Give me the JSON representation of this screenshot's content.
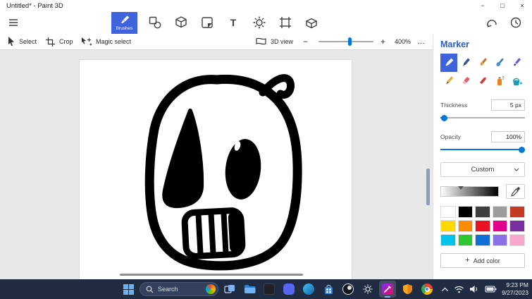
{
  "colors": {
    "accent_blue": "#3e63dd",
    "slider_blue": "#0078d7",
    "panel_title_blue": "#2a5cc8",
    "taskbar_bg": "#202c42",
    "canvas_workspace_bg": "#e8e8e8",
    "ink": "#000000"
  },
  "window": {
    "title": "Untitled* - Paint 3D",
    "minimize_glyph": "−",
    "maximize_glyph": "□",
    "close_glyph": "×"
  },
  "main_toolbar": {
    "selected_tool_label": "Brushes",
    "text_tool_glyph": "T",
    "tool_icons": [
      "menu-icon",
      "brushes-icon",
      "2d-shapes-icon",
      "3d-shapes-icon",
      "stickers-icon",
      "text-icon",
      "effects-icon",
      "canvas-icon",
      "3d-library-icon",
      "undo-icon",
      "history-icon"
    ]
  },
  "sub_toolbar": {
    "select": "Select",
    "crop": "Crop",
    "magic_select": "Magic select",
    "view_3d": "3D view",
    "zoom_out_glyph": "−",
    "zoom_in_glyph": "+",
    "zoom_level": "400%",
    "more_glyph": "…"
  },
  "panel": {
    "title": "Marker",
    "brush_icons": [
      "marker-icon",
      "calligraphy-pen-icon",
      "oil-brush-icon",
      "watercolour-icon",
      "pixel-pen-icon",
      "pencil-icon",
      "eraser-icon",
      "crayon-icon",
      "spray-can-icon",
      "fill-icon"
    ],
    "selected_brush": "marker",
    "thickness_label": "Thickness",
    "thickness_value": "5 px",
    "opacity_label": "Opacity",
    "opacity_value": "100%",
    "palette_dropdown": "Custom",
    "swatches": [
      "#ffffff",
      "#000000",
      "#3f3f3f",
      "#9c9c9c",
      "#c23b22",
      "#ffd800",
      "#ff8c00",
      "#e81224",
      "#e3008c",
      "#7a2f9e",
      "#00c3eb",
      "#2fc62f",
      "#0f6fd7",
      "#8a6fe8",
      "#f7a7c9"
    ],
    "add_color_plus": "+",
    "add_color_label": "Add color"
  },
  "taskbar": {
    "search_label": "Search",
    "time": "9:23 PM",
    "date": "9/27/2023",
    "app_icons": [
      "start-icon",
      "search-icon",
      "task-view-icon",
      "file-explorer-icon",
      "terminal-icon",
      "discord-icon",
      "edge-icon",
      "store-icon",
      "obs-icon",
      "settings-icon",
      "paint3d-icon",
      "defender-icon",
      "chrome-icon"
    ],
    "tray_icons": [
      "chevron-up-icon",
      "wifi-icon",
      "volume-icon",
      "battery-icon"
    ]
  }
}
